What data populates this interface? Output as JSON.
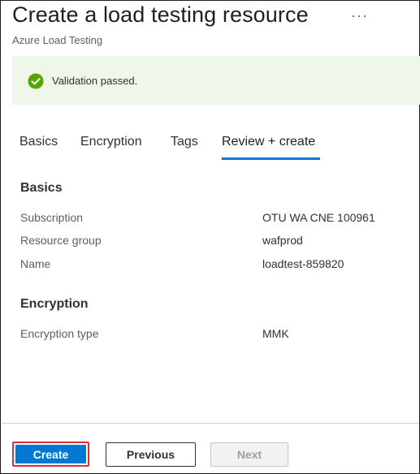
{
  "header": {
    "title": "Create a load testing resource",
    "subtitle": "Azure Load Testing",
    "more_label": "···"
  },
  "banner": {
    "text": "Validation passed.",
    "icon": "success-check-icon",
    "color": "#57a300"
  },
  "tabs": [
    {
      "label": "Basics",
      "active": false
    },
    {
      "label": "Encryption",
      "active": false
    },
    {
      "label": "Tags",
      "active": false
    },
    {
      "label": "Review + create",
      "active": true
    }
  ],
  "review": {
    "basics": {
      "heading": "Basics",
      "rows": [
        {
          "label": "Subscription",
          "value": "OTU WA CNE 100961"
        },
        {
          "label": "Resource group",
          "value": "wafprod"
        },
        {
          "label": "Name",
          "value": "loadtest-859820"
        }
      ]
    },
    "encryption": {
      "heading": "Encryption",
      "rows": [
        {
          "label": "Encryption type",
          "value": "MMK"
        }
      ]
    }
  },
  "footer": {
    "create_label": "Create",
    "previous_label": "Previous",
    "next_label": "Next",
    "next_disabled": true
  },
  "colors": {
    "accent": "#0078d4",
    "highlight_border": "#d4323a",
    "banner_bg": "#eff6ea"
  }
}
